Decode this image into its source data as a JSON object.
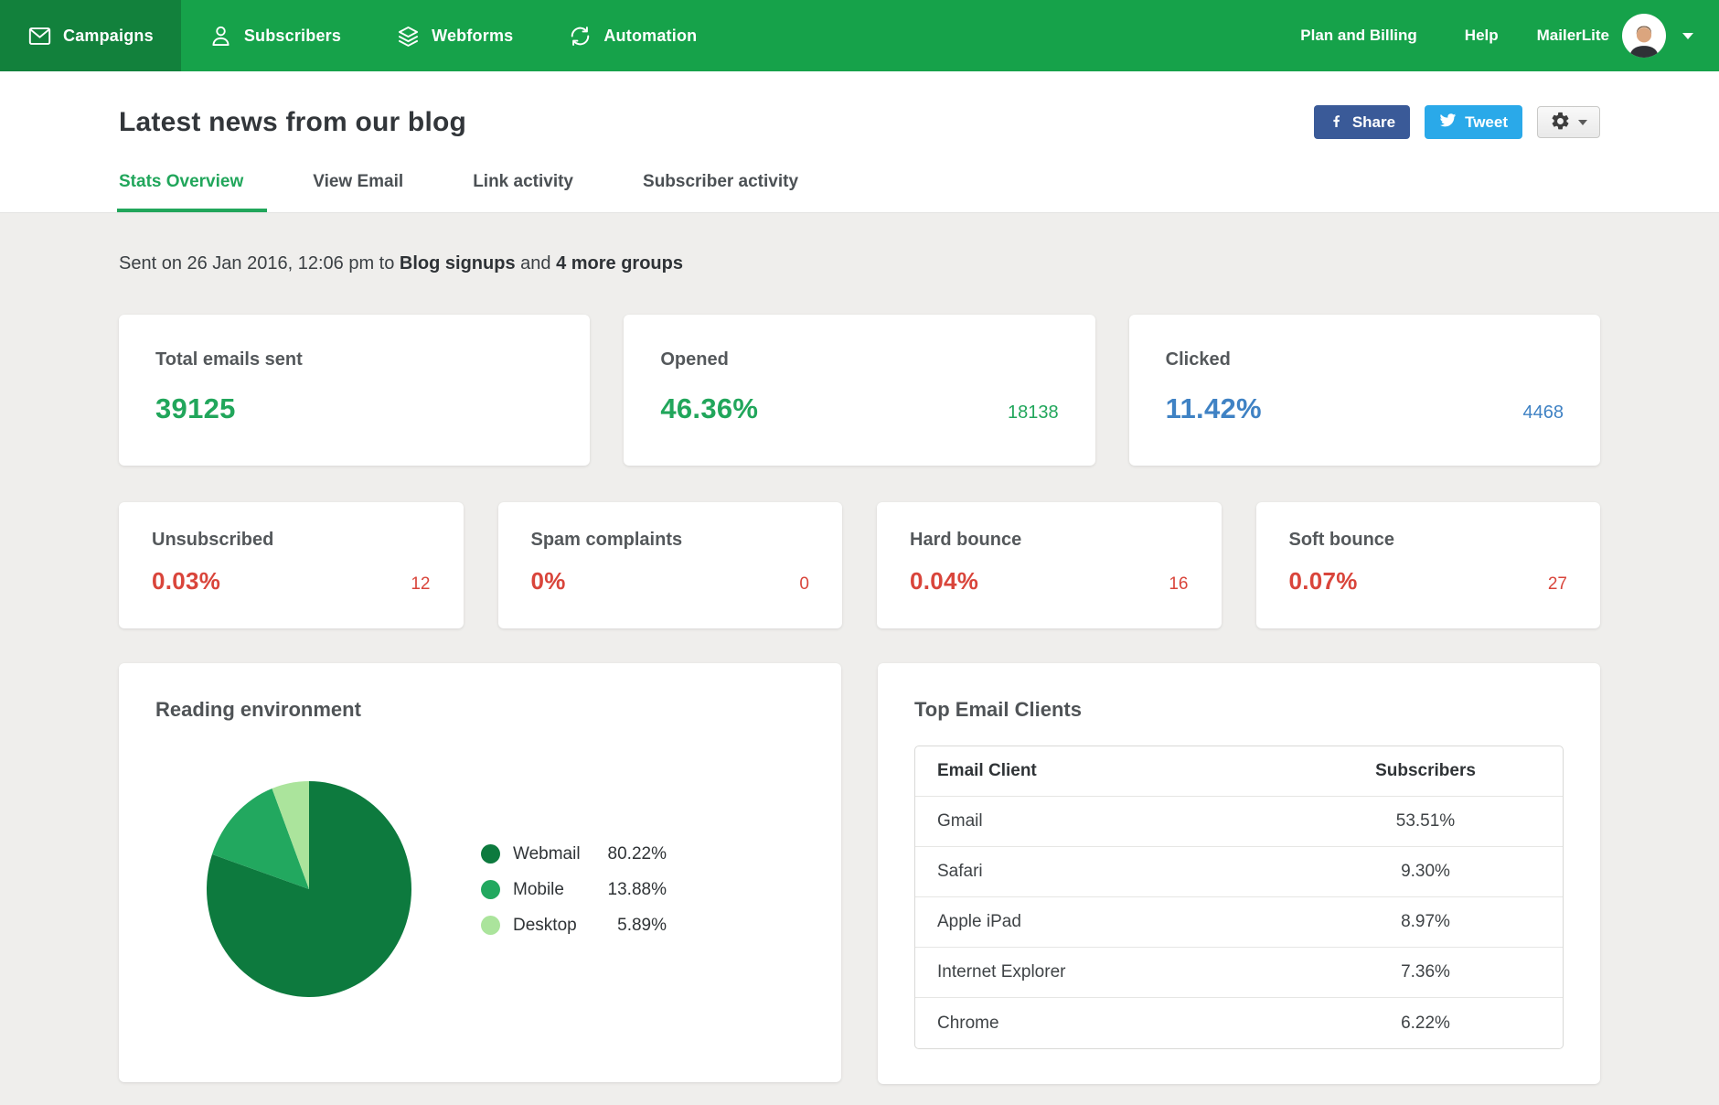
{
  "nav": {
    "items": [
      {
        "label": "Campaigns",
        "icon": "envelope-icon",
        "active": true
      },
      {
        "label": "Subscribers",
        "icon": "person-icon",
        "active": false
      },
      {
        "label": "Webforms",
        "icon": "layers-icon",
        "active": false
      },
      {
        "label": "Automation",
        "icon": "sync-icon",
        "active": false
      }
    ],
    "plan_label": "Plan and Billing",
    "help_label": "Help",
    "account_name": "MailerLite"
  },
  "header": {
    "title": "Latest news from our blog",
    "share_label": "Share",
    "tweet_label": "Tweet",
    "tabs": [
      {
        "label": "Stats Overview",
        "active": true
      },
      {
        "label": "View Email",
        "active": false
      },
      {
        "label": "Link activity",
        "active": false
      },
      {
        "label": "Subscriber activity",
        "active": false
      }
    ]
  },
  "sent_line": {
    "prefix": "Sent on 26 Jan 2016, 12:06 pm to ",
    "group": "Blog signups",
    "conjunction": " and ",
    "more_groups": "4 more groups"
  },
  "stats_primary": [
    {
      "label": "Total emails sent",
      "value": "39125",
      "count": "",
      "accent": "#21a65b"
    },
    {
      "label": "Opened",
      "value": "46.36%",
      "count": "18138",
      "accent": "#21a65b"
    },
    {
      "label": "Clicked",
      "value": "11.42%",
      "count": "4468",
      "accent": "#3f82c4"
    }
  ],
  "stats_secondary": [
    {
      "label": "Unsubscribed",
      "value": "0.03%",
      "count": "12",
      "accent": "#d9453b"
    },
    {
      "label": "Spam complaints",
      "value": "0%",
      "count": "0",
      "accent": "#d9453b"
    },
    {
      "label": "Hard bounce",
      "value": "0.04%",
      "count": "16",
      "accent": "#d9453b"
    },
    {
      "label": "Soft bounce",
      "value": "0.07%",
      "count": "27",
      "accent": "#d9453b"
    }
  ],
  "chart_data": {
    "type": "pie",
    "title": "Reading environment",
    "labels": [
      "Webmail",
      "Mobile",
      "Desktop"
    ],
    "values": [
      80.22,
      13.88,
      5.89
    ],
    "value_labels": [
      "80.22%",
      "13.88%",
      "5.89%"
    ],
    "colors": [
      "#0d7a3e",
      "#22a85f",
      "#abe49c"
    ],
    "start_angle_deg": 0,
    "direction": "clockwise",
    "legend_position": "right"
  },
  "email_clients": {
    "title": "Top Email Clients",
    "columns": [
      "Email Client",
      "Subscribers"
    ],
    "rows": [
      {
        "client": "Gmail",
        "share": "53.51%"
      },
      {
        "client": "Safari",
        "share": "9.30%"
      },
      {
        "client": "Apple iPad",
        "share": "8.97%"
      },
      {
        "client": "Internet Explorer",
        "share": "7.36%"
      },
      {
        "client": "Chrome",
        "share": "6.22%"
      }
    ]
  },
  "colors": {
    "nav_green": "#16a24a",
    "nav_active_green": "#12813c",
    "value_green": "#21a65b",
    "value_blue": "#3f82c4",
    "value_red": "#d9453b",
    "facebook_blue": "#3a5a98",
    "twitter_blue": "#2aa9e9",
    "page_background": "#efeeec"
  }
}
